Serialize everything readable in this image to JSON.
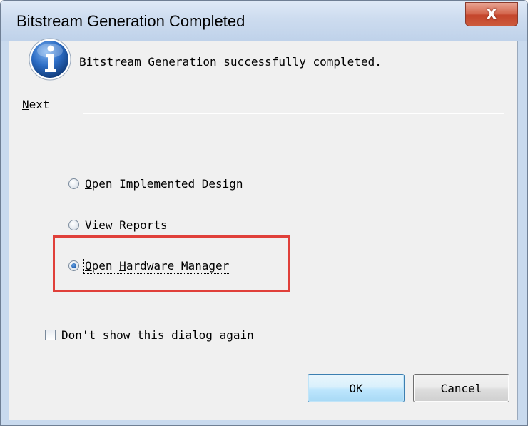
{
  "window": {
    "title": "Bitstream Generation Completed",
    "close_glyph": "X"
  },
  "message": {
    "icon": "info-icon",
    "text": "Bitstream Generation successfully completed."
  },
  "next_section": {
    "label_underlined": "N",
    "label_rest": "ext"
  },
  "options": [
    {
      "mnemonic": "O",
      "rest": "pen Implemented Design",
      "selected": false
    },
    {
      "mnemonic": "V",
      "rest": "iew Reports",
      "selected": false
    },
    {
      "part1_mnemonic": "O",
      "part1_rest": "pen ",
      "part2_mnemonic": "H",
      "part2_rest": "ardware Manager",
      "selected": true
    }
  ],
  "dont_show": {
    "mnemonic": "D",
    "rest": "on't show this dialog again",
    "checked": false
  },
  "buttons": {
    "ok": "OK",
    "cancel": "Cancel"
  },
  "colors": {
    "highlight_box": "#e0403a",
    "close_button": "#c4452c",
    "info_icon": "#1f5fb0"
  }
}
